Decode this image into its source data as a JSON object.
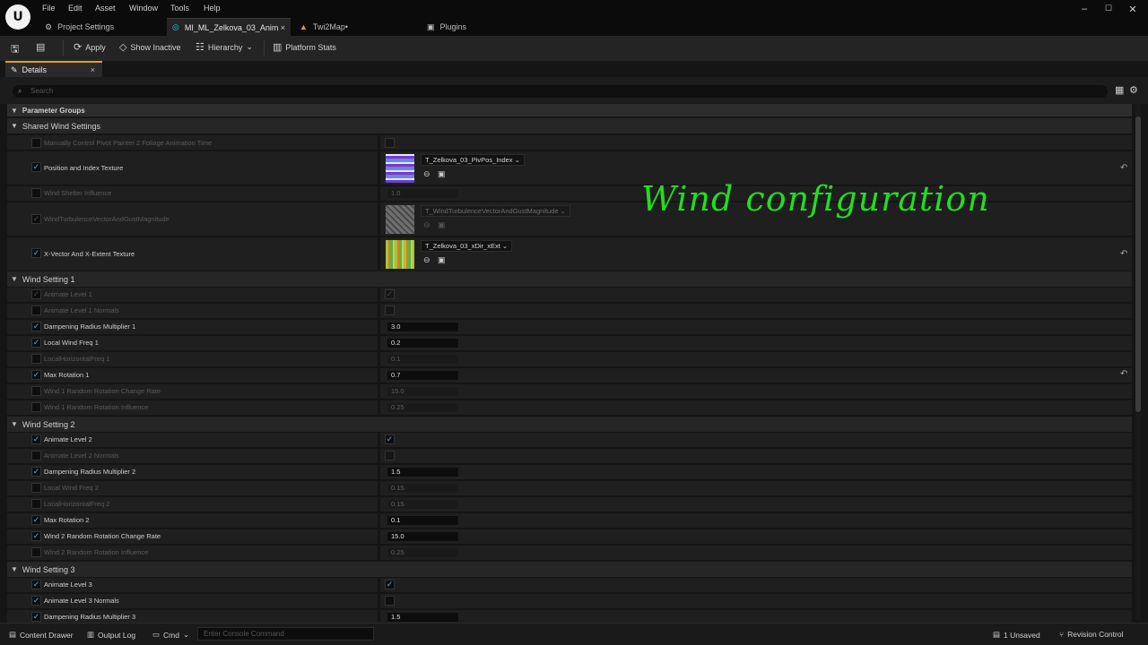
{
  "menu": [
    "File",
    "Edit",
    "Asset",
    "Window",
    "Tools",
    "Help"
  ],
  "tabs": [
    {
      "label": "Project Settings",
      "icon": "settings-icon"
    },
    {
      "label": "MI_ML_Zelkova_03_Anim",
      "icon": "material-icon",
      "close": "×"
    },
    {
      "label": "Twi2Map•",
      "icon": "level-icon"
    },
    {
      "label": "Plugins",
      "icon": "plugin-icon"
    }
  ],
  "toolbar": {
    "apply": "Apply",
    "show_inactive": "Show Inactive",
    "hierarchy": "Hierarchy",
    "platform_stats": "Platform Stats"
  },
  "details_tab": {
    "label": "Details",
    "close": "×"
  },
  "search": {
    "placeholder": "Search"
  },
  "overlay_text": "Wind configuration",
  "parameter_groups": "Parameter Groups",
  "groups": [
    {
      "title": "Shared Wind Settings"
    },
    {
      "title": "Wind Setting 1"
    },
    {
      "title": "Wind Setting 2"
    },
    {
      "title": "Wind Setting 3"
    }
  ],
  "shared": {
    "r0": {
      "label": "Manually Control Pivot Painter 2 Foliage Animation Time"
    },
    "r1": {
      "label": "Position and Index Texture",
      "texture": "T_Zelkova_03_PivPos_Index"
    },
    "r2": {
      "label": "Wind Shelter Influence",
      "value": "1.0"
    },
    "r3": {
      "label": "WindTurbulenceVectorAndGustMagnitude",
      "texture": "T_WindTurbulenceVectorAndGustMagnitude"
    },
    "r4": {
      "label": "X-Vector And X-Extent Texture",
      "texture": "T_Zelkova_03_xDir_xExt"
    }
  },
  "ws1": [
    {
      "label": "Animate Level 1",
      "value": ""
    },
    {
      "label": "Animate Level 1 Normals",
      "value": ""
    },
    {
      "label": "Dampening Radius Multiplier 1",
      "value": "3.0"
    },
    {
      "label": "Local Wind Freq  1",
      "value": "0.2"
    },
    {
      "label": "LocalHorizontalFreq 1",
      "value": "0.1"
    },
    {
      "label": "Max Rotation 1",
      "value": "0.7"
    },
    {
      "label": "Wind 1 Random Rotation Change Rate",
      "value": "15.0"
    },
    {
      "label": "Wind 1 Random Rotation Influence",
      "value": "0.25"
    }
  ],
  "ws2": [
    {
      "label": "Animate Level 2",
      "value": ""
    },
    {
      "label": "Animate Level 2 Normals",
      "value": ""
    },
    {
      "label": "Dampening Radius Multiplier 2",
      "value": "1.5"
    },
    {
      "label": "Local Wind Freq 2",
      "value": "0.15"
    },
    {
      "label": "LocalHorizontalFreq 2",
      "value": "0.15"
    },
    {
      "label": "Max Rotation 2",
      "value": "0.1"
    },
    {
      "label": "Wind 2 Random Rotation Change Rate",
      "value": "15.0"
    },
    {
      "label": "Wind 2 Random Rotation Influence",
      "value": "0.25"
    }
  ],
  "ws3": [
    {
      "label": "Animate Level 3",
      "value": ""
    },
    {
      "label": "Animate Level 3 Normals",
      "value": ""
    },
    {
      "label": "Dampening Radius Multiplier 3",
      "value": "1.5"
    }
  ],
  "status": {
    "content_drawer": "Content Drawer",
    "output_log": "Output Log",
    "cmd": "Cmd",
    "console_placeholder": "Enter Console Command",
    "unsaved": "1 Unsaved",
    "revision": "Revision Control"
  },
  "colors": {
    "accent": "#e0a020",
    "check": "#5ea3e6",
    "overlay": "#22dd22"
  }
}
